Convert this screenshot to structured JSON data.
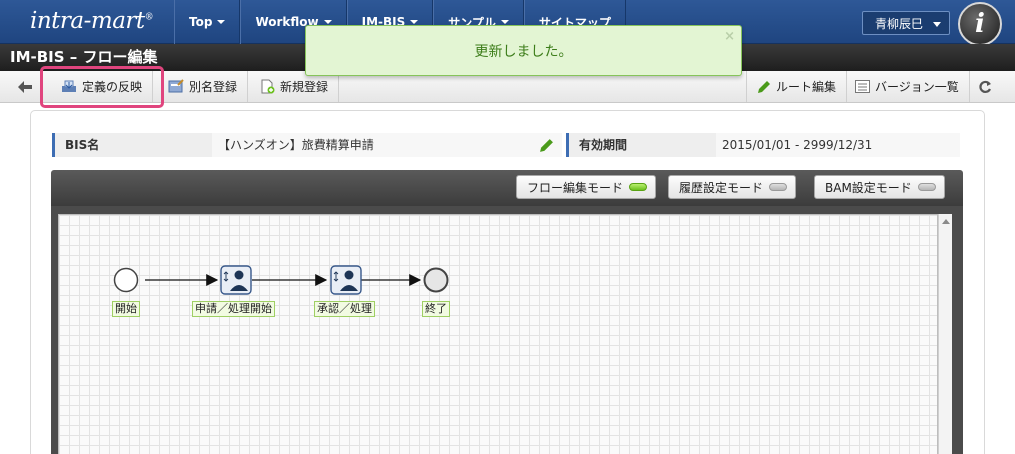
{
  "nav": {
    "logo": "intra-mart",
    "items": [
      {
        "label": "Top",
        "caret": true
      },
      {
        "label": "Workflow",
        "caret": true
      },
      {
        "label": "IM-BIS",
        "caret": true
      },
      {
        "label": "サンプル",
        "caret": true
      },
      {
        "label": "サイトマップ",
        "caret": false
      }
    ],
    "user": "青柳辰巳",
    "avatar_letter": "i"
  },
  "title": "IM-BIS – フロー編集",
  "flash": {
    "message": "更新しました。",
    "close": "×"
  },
  "toolbar": {
    "back_icon": "arrow-left-icon",
    "apply": "定義の反映",
    "alias": "別名登録",
    "new": "新規登録",
    "route_edit": "ルート編集",
    "version_list": "バージョン一覧",
    "refresh_icon": "refresh-icon"
  },
  "info": {
    "bis_name_label": "BIS名",
    "bis_name_value": "【ハンズオン】旅費精算申請",
    "period_label": "有効期間",
    "period_value": "2015/01/01 ‐ 2999/12/31"
  },
  "modes": [
    {
      "label": "フロー編集モード",
      "active": true
    },
    {
      "label": "履歴設定モード",
      "active": false
    },
    {
      "label": "BAM設定モード",
      "active": false
    }
  ],
  "flow": {
    "nodes": [
      {
        "type": "start",
        "label": "開始"
      },
      {
        "type": "task",
        "label": "申請／処理開始"
      },
      {
        "type": "task",
        "label": "承認／処理"
      },
      {
        "type": "end",
        "label": "終了"
      }
    ]
  },
  "colors": {
    "nav_bg": "#2e5897",
    "flash_bg": "#e3f5d3",
    "flash_text": "#3d7d1a",
    "highlight": "#e0457e",
    "led_on": "#6cc11e"
  }
}
